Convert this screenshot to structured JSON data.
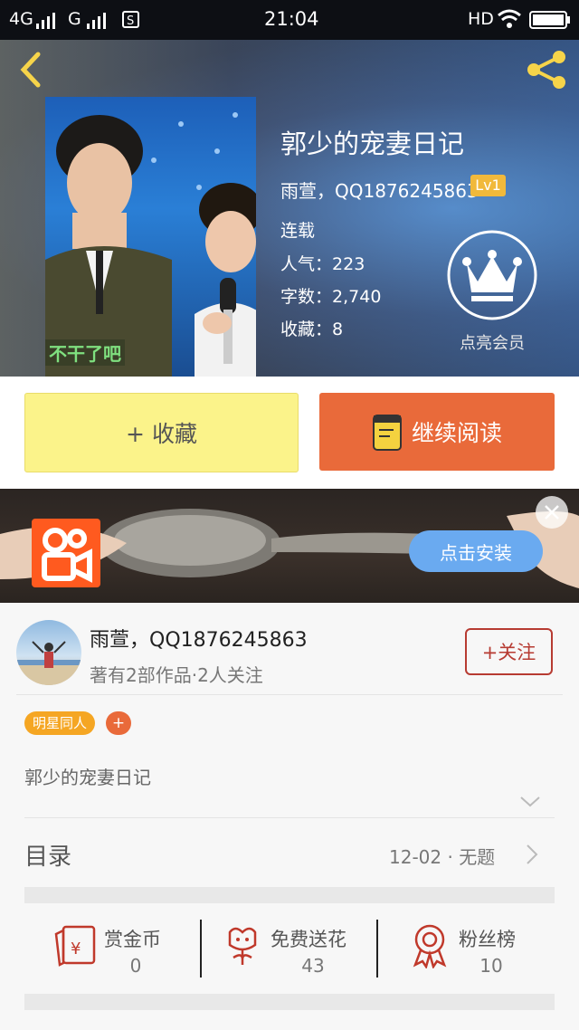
{
  "status_bar": {
    "network1": "4G",
    "network2": "G",
    "time": "21:04",
    "hd": "HD"
  },
  "book": {
    "title": "郭少的宠妻日记",
    "author": "雨萱，QQ1876245863",
    "level": "Lv1",
    "status": "连载",
    "popularity_label": "人气：",
    "popularity": "223",
    "words_label": "字数：",
    "words": "2,740",
    "favorites_label": "收藏：",
    "favorites": "8",
    "cover_caption": "不干了吧"
  },
  "vip": {
    "label": "点亮会员"
  },
  "actions": {
    "favorite_label": "+ 收藏",
    "continue_label": "继续阅读"
  },
  "ad": {
    "install_label": "点击安装"
  },
  "author_card": {
    "name": "雨萱，QQ1876245863",
    "stats": "著有2部作品·2人关注",
    "follow_label": "+关注"
  },
  "tags": {
    "items": [
      "明星同人"
    ],
    "add_label": "+"
  },
  "intro": {
    "text": "郭少的宠妻日记"
  },
  "catalog": {
    "label": "目录",
    "latest": "12-02 · 无题"
  },
  "stats_row": [
    {
      "label": "赏金币",
      "value": "0",
      "icon": "red-envelope-icon"
    },
    {
      "label": "免费送花",
      "value": "43",
      "icon": "flower-icon"
    },
    {
      "label": "粉丝榜",
      "value": "10",
      "icon": "medal-icon"
    }
  ],
  "colors": {
    "favorite_bg": "#fbf38a",
    "continue_bg": "#e96a3a",
    "accent_red": "#c0392b",
    "install_bg": "#6aaaf0",
    "tag_bg": "#f5a623"
  }
}
